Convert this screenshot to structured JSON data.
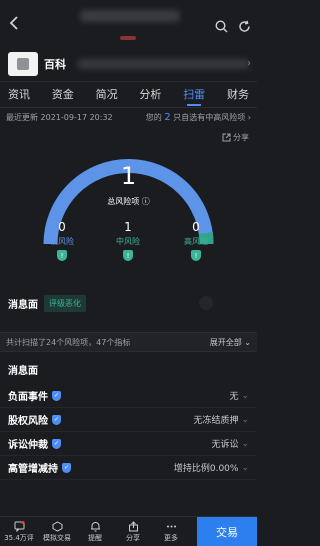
{
  "company": {
    "name": "百科"
  },
  "tabs": [
    "资讯",
    "资金",
    "简况",
    "分析",
    "扫雷",
    "财务"
  ],
  "active_tab": 4,
  "update": {
    "time_text": "最近更新 2021-09-17 20:32",
    "rank_prefix": "您的",
    "rank_num": "2",
    "rank_suffix": "只自选有中高风险项"
  },
  "share_label": "分享",
  "gauge": {
    "total_risk": "1",
    "total_label": "总风险项",
    "low": {
      "count": "0",
      "label": "低风险",
      "color": "#3db49a"
    },
    "mid": {
      "count": "1",
      "label": "中风险",
      "color": "#3db49a"
    },
    "high": {
      "count": "0",
      "label": "高风险",
      "color": "#3db49a"
    },
    "arc_color": "#5d94e8",
    "arc_end_color": "#2fa58b"
  },
  "message": {
    "label": "消息面",
    "badge": "评级恶化"
  },
  "scan": {
    "summary": "共计扫描了24个风险项，47个指标",
    "expand": "展开全部"
  },
  "detail": {
    "section_title": "消息面",
    "rows": [
      {
        "label": "负面事件",
        "value": "无"
      },
      {
        "label": "股权风险",
        "value": "无冻结质押"
      },
      {
        "label": "诉讼仲裁",
        "value": "无诉讼"
      },
      {
        "label": "高管增减持",
        "value": "增持比例0.00%"
      }
    ]
  },
  "bottom_nav": [
    {
      "label": "35.4万评",
      "icon": "comment-icon"
    },
    {
      "label": "模拟交易",
      "icon": "simulate-icon"
    },
    {
      "label": "提醒",
      "icon": "bell-icon"
    },
    {
      "label": "分享",
      "icon": "share-icon"
    },
    {
      "label": "更多",
      "icon": "more-icon"
    }
  ],
  "trade_label": "交易"
}
